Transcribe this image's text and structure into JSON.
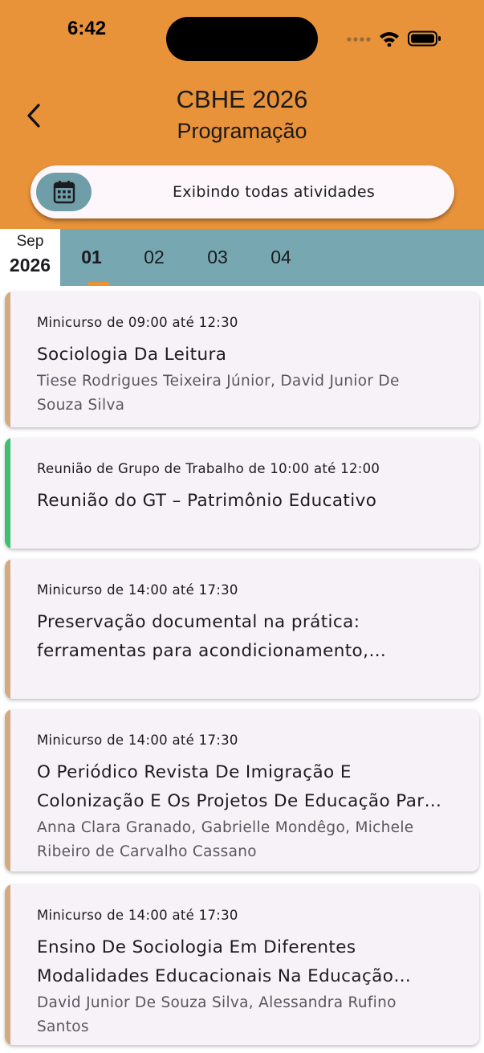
{
  "status_bar": {
    "time": "6:42"
  },
  "header": {
    "title": "CBHE 2026",
    "subtitle": "Programação",
    "back_icon": "chevron-left-icon"
  },
  "filter": {
    "text": "Exibindo todas atividades",
    "icon": "calendar-icon"
  },
  "date_selector": {
    "month": "Sep",
    "year": "2026",
    "days": [
      "01",
      "02",
      "03",
      "04"
    ],
    "selected_day": "01"
  },
  "colors": {
    "header": "#e8923a",
    "days_bar": "#77a7b1",
    "minicurso_stripe": "#d4aa80",
    "grupo_stripe": "#3ec16e"
  },
  "events": [
    {
      "meta": "Minicurso de 09:00 até 12:30",
      "title": "Sociologia Da Leitura",
      "authors": "Tiese Rodrigues Teixeira Júnior, David Junior De Souza Silva",
      "stripe": "#d4aa80"
    },
    {
      "meta": "Reunião de Grupo de Trabalho de 10:00 até 12:00",
      "title": "Reunião do GT – Patrimônio Educativo",
      "authors": "",
      "stripe": "#3ec16e"
    },
    {
      "meta": "Minicurso de 14:00 até 17:30",
      "title": "Preservação documental na prática: ferramentas para acondicionamento, arquivamento e conservação de acervos escolares",
      "authors": "",
      "stripe": "#d4aa80"
    },
    {
      "meta": "Minicurso de 14:00 até 17:30",
      "title": "O Periódico Revista De Imigração E Colonização E Os Projetos De Educação Para A Nacionalização",
      "authors": "Anna Clara Granado, Gabrielle Mondêgo, Michele Ribeiro de Carvalho Cassano",
      "stripe": "#d4aa80"
    },
    {
      "meta": "Minicurso de 14:00 até 17:30",
      "title": "Ensino De Sociologia Em Diferentes Modalidades Educacionais Na Educação Básica",
      "authors": "David Junior De Souza Silva, Alessandra Rufino Santos",
      "stripe": "#d4aa80"
    }
  ]
}
